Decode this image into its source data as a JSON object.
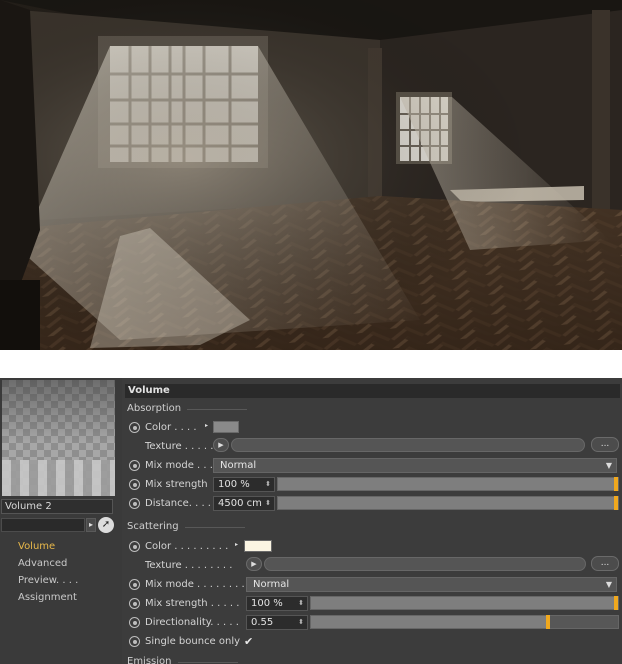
{
  "render": {
    "description_icon": "rendered-room-image"
  },
  "material": {
    "name": "Volume 2"
  },
  "nav": {
    "items": [
      {
        "label": "Volume",
        "active": true
      },
      {
        "label": "Advanced",
        "active": false
      },
      {
        "label": "Preview. . . .",
        "active": false
      },
      {
        "label": "Assignment",
        "active": false
      }
    ]
  },
  "panel": {
    "title": "Volume",
    "absorption": {
      "heading": "Absorption",
      "color_label": "Color . . . .",
      "color_value": "#8a8a8a",
      "texture_label": "Texture . . . . .",
      "more_label": "...",
      "mix_mode_label": "Mix mode . . .",
      "mix_mode_value": "Normal",
      "mix_strength_label": "Mix strength",
      "mix_strength_value": "100 %",
      "mix_strength_fraction": 1.0,
      "distance_label": "Distance. . . .",
      "distance_value": "4500 cm",
      "distance_fraction": 1.0
    },
    "scattering": {
      "heading": "Scattering",
      "color_label": "Color . . . . . . . . .",
      "color_value": "#fbf5e3",
      "texture_label": "Texture . . . . . . . .",
      "more_label": "...",
      "mix_mode_label": "Mix mode . . . . . . . . .",
      "mix_mode_value": "Normal",
      "mix_strength_label": "Mix strength . . . . .",
      "mix_strength_value": "100 %",
      "mix_strength_fraction": 1.0,
      "directionality_label": "Directionality. . . . .",
      "directionality_value": "0.55",
      "directionality_fraction": 0.78,
      "single_bounce_label": "Single bounce only",
      "single_bounce_checked": "✔"
    },
    "emission": {
      "heading": "Emission"
    }
  },
  "colors": {
    "accent": "#f0a81e",
    "active_nav": "#e8b84a",
    "panel_bg": "#3c3c3c"
  }
}
